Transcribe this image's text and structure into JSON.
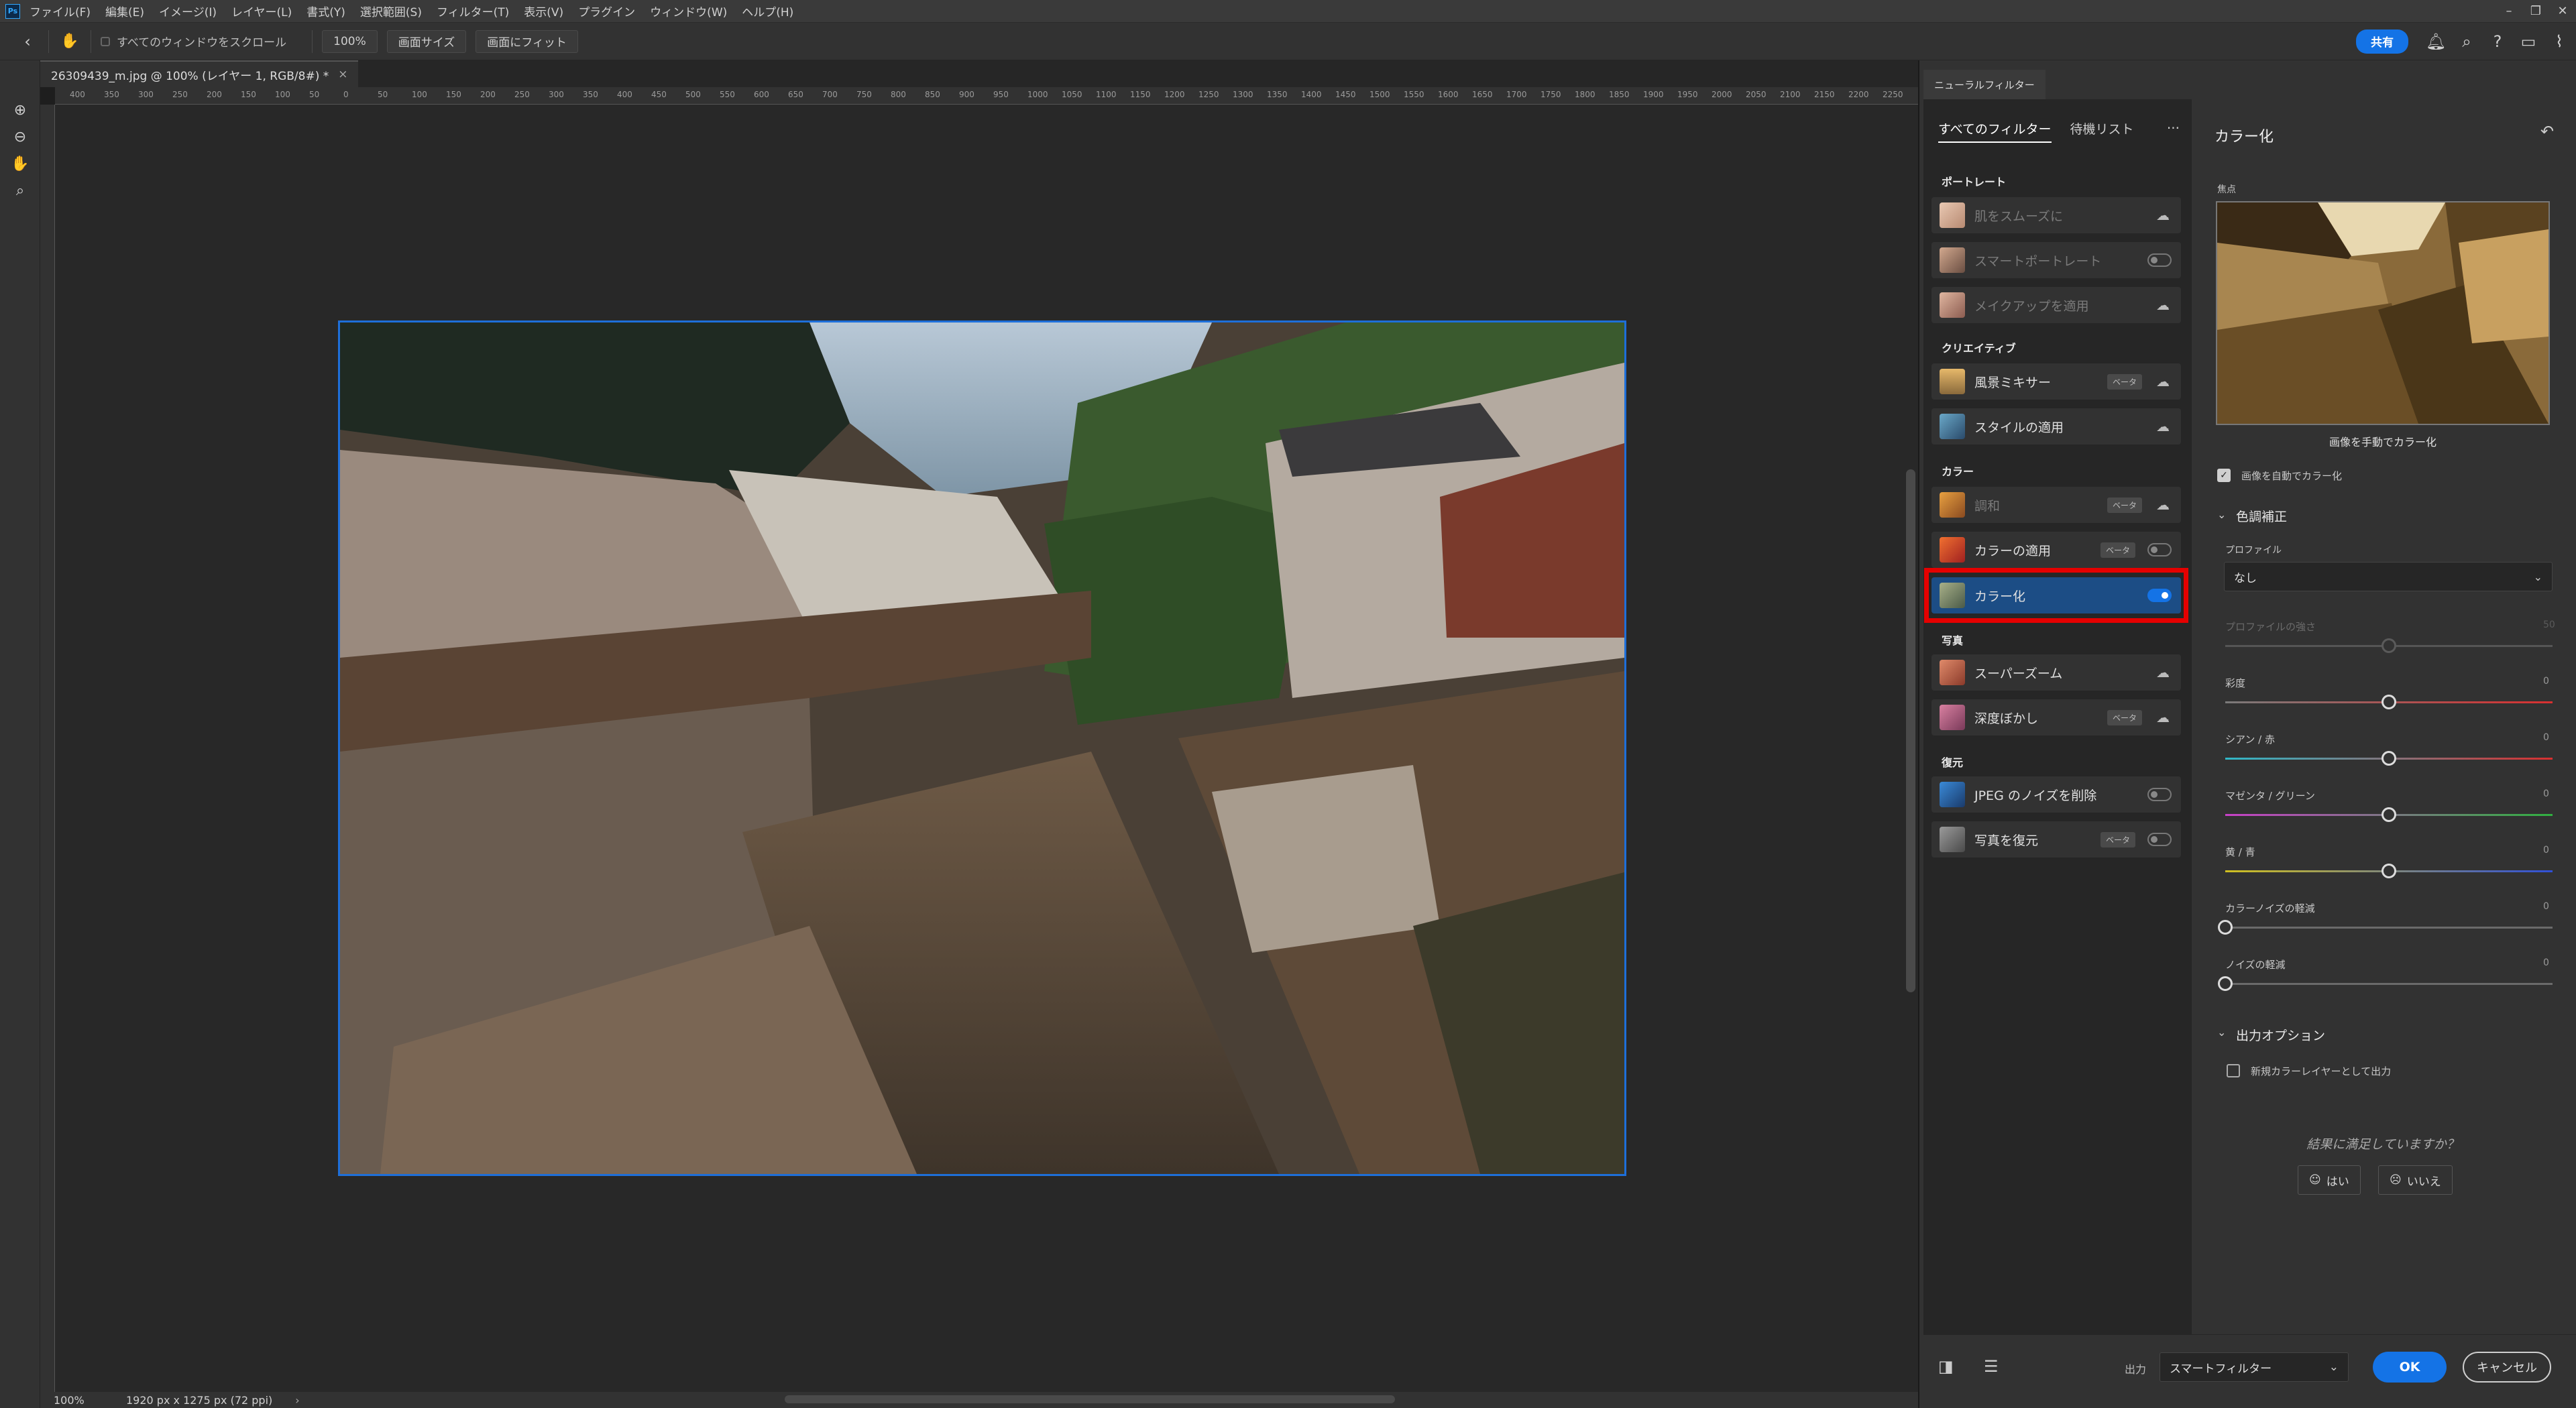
{
  "menubar": {
    "app_icon": "Ps",
    "items": [
      "ファイル(F)",
      "編集(E)",
      "イメージ(I)",
      "レイヤー(L)",
      "書式(Y)",
      "選択範囲(S)",
      "フィルター(T)",
      "表示(V)",
      "プラグイン",
      "ウィンドウ(W)",
      "ヘルプ(H)"
    ]
  },
  "options_bar": {
    "scroll_all_label": "すべてのウィンドウをスクロール",
    "zoom_value": "100%",
    "fit_screen_size": "画面サイズ",
    "fit_screen": "画面にフィット",
    "share_label": "共有"
  },
  "document": {
    "tab_title": "26309439_m.jpg @ 100% (レイヤー 1, RGB/8#) *",
    "close_glyph": "×",
    "ruler_ticks": [
      "400",
      "350",
      "300",
      "250",
      "200",
      "150",
      "100",
      "50",
      "0",
      "50",
      "100",
      "150",
      "200",
      "250",
      "300",
      "350",
      "400",
      "450",
      "500",
      "550",
      "600",
      "650",
      "700",
      "750",
      "800",
      "850",
      "900",
      "950",
      "1000",
      "1050",
      "1100",
      "1150",
      "1200",
      "1250",
      "1300",
      "1350",
      "1400",
      "1450",
      "1500",
      "1550",
      "1600",
      "1650",
      "1700",
      "1750",
      "1800",
      "1850",
      "1900",
      "1950",
      "2000",
      "2050",
      "2100",
      "2150",
      "2200",
      "2250"
    ],
    "status_zoom": "100%",
    "status_dims": "1920 px x 1275 px (72 ppi)",
    "status_arrow": "›"
  },
  "panel": {
    "tab_label": "ニューラルフィルター",
    "tabs": [
      "すべてのフィルター",
      "待機リスト"
    ],
    "more_glyph": "···",
    "categories": [
      {
        "label": "ポートレート",
        "filters": [
          {
            "name": "肌をスムーズに",
            "control": "cloud",
            "dim": true
          },
          {
            "name": "スマートポートレート",
            "control": "toggle",
            "dim": true
          },
          {
            "name": "メイクアップを適用",
            "control": "cloud",
            "dim": true
          }
        ]
      },
      {
        "label": "クリエイティブ",
        "filters": [
          {
            "name": "風景ミキサー",
            "beta": "ベータ",
            "control": "cloud"
          },
          {
            "name": "スタイルの適用",
            "control": "cloud"
          }
        ]
      },
      {
        "label": "カラー",
        "filters": [
          {
            "name": "調和",
            "beta": "ベータ",
            "control": "cloud",
            "dim": true
          },
          {
            "name": "カラーの適用",
            "beta": "ベータ",
            "control": "toggle"
          },
          {
            "name": "カラー化",
            "control": "toggle-on",
            "selected": true
          }
        ]
      },
      {
        "label": "写真",
        "filters": [
          {
            "name": "スーパーズーム",
            "control": "cloud"
          },
          {
            "name": "深度ぼかし",
            "beta": "ベータ",
            "control": "cloud"
          }
        ]
      },
      {
        "label": "復元",
        "filters": [
          {
            "name": "JPEG のノイズを削除",
            "control": "toggle"
          },
          {
            "name": "写真を復元",
            "beta": "ベータ",
            "control": "toggle"
          }
        ]
      }
    ]
  },
  "settings": {
    "title": "カラー化",
    "focus_label": "焦点",
    "manual_label": "画像を手動でカラー化",
    "auto_label": "画像を自動でカラー化",
    "color_adjust": "色調補正",
    "profile_label": "プロファイル",
    "profile_value": "なし",
    "sliders": [
      {
        "label": "プロファイルの強さ",
        "value": "50",
        "pos": 0.5,
        "disabled": true,
        "gradient": [
          "#555555",
          "#555555"
        ]
      },
      {
        "label": "彩度",
        "value": "0",
        "pos": 0.5,
        "gradient": [
          "#7a7a7a",
          "#d83030"
        ]
      },
      {
        "label": "シアン / 赤",
        "value": "0",
        "pos": 0.5,
        "gradient": [
          "#2fb8c8",
          "#d83030"
        ]
      },
      {
        "label": "マゼンタ / グリーン",
        "value": "0",
        "pos": 0.5,
        "gradient": [
          "#c840c8",
          "#30b040"
        ]
      },
      {
        "label": "黄 / 青",
        "value": "0",
        "pos": 0.5,
        "gradient": [
          "#d0c020",
          "#3050d8"
        ]
      },
      {
        "label": "カラーノイズの軽減",
        "value": "0",
        "pos": 0.0,
        "gradient": [
          "#6a6a6a",
          "#6a6a6a"
        ]
      },
      {
        "label": "ノイズの軽減",
        "value": "0",
        "pos": 0.0,
        "gradient": [
          "#6a6a6a",
          "#6a6a6a"
        ]
      }
    ],
    "output_options": "出力オプション",
    "new_layer_label": "新規カラーレイヤーとして出力",
    "feedback_question": "結果に満足していますか？",
    "yes_label": "はい",
    "no_label": "いいえ"
  },
  "footer": {
    "output_label": "出力",
    "output_value": "スマートフィルター",
    "ok_label": "OK",
    "cancel_label": "キャンセル"
  },
  "colors": {
    "accent": "#1473e6",
    "selected_row": "#1c4d85",
    "highlight_box": "#e50000"
  }
}
